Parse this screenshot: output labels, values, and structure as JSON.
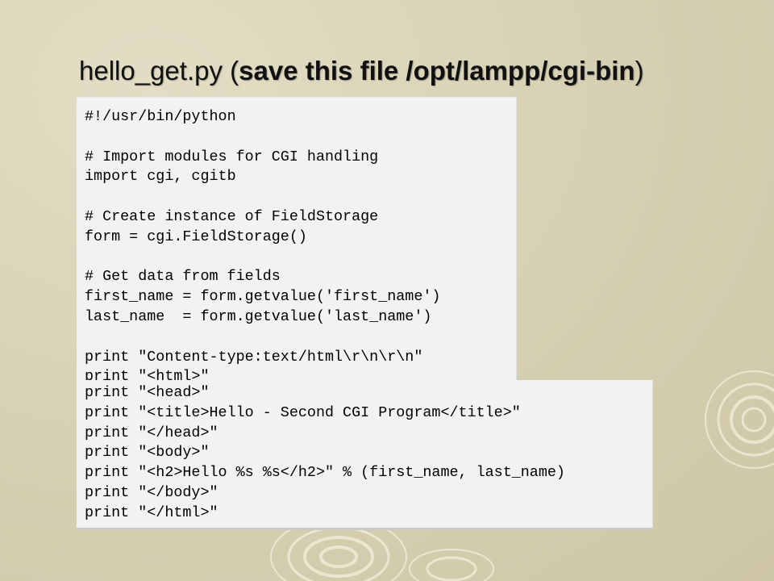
{
  "slide": {
    "title_main": "hello_get.py",
    "title_paren_open": " (",
    "title_note": "save this file /opt/lampp/cgi-bin",
    "title_paren_close": ")"
  },
  "code_panel_1": [
    "#!/usr/bin/python",
    "",
    "# Import modules for CGI handling",
    "import cgi, cgitb",
    "",
    "# Create instance of FieldStorage",
    "form = cgi.FieldStorage()",
    "",
    "# Get data from fields",
    "first_name = form.getvalue('first_name')",
    "last_name  = form.getvalue('last_name')",
    "",
    "print \"Content-type:text/html\\r\\n\\r\\n\"",
    "print \"<html>\""
  ],
  "code_panel_2": [
    "print \"<head>\"",
    "print \"<title>Hello - Second CGI Program</title>\"",
    "print \"</head>\"",
    "print \"<body>\"",
    "print \"<h2>Hello %s %s</h2>\" % (first_name, last_name)",
    "print \"</body>\"",
    "print \"</html>\""
  ],
  "colors": {
    "background": "#d6d0b2",
    "ring": "#f3efdc",
    "code_bg": "#f2f2f2"
  }
}
